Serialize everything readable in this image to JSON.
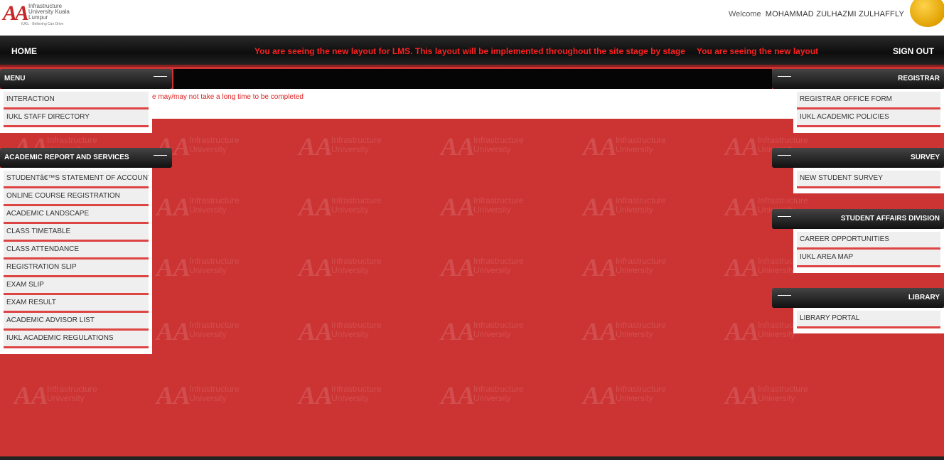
{
  "header": {
    "logo_mark": "AA",
    "logo_name": "Infrastructure University Kuala Lumpur",
    "logo_tagline": "IUKL · Believing Can Drive",
    "welcome_label": "Welcome",
    "user_name": "MOHAMMAD ZULHAZMI ZULHAFFLY"
  },
  "navbar": {
    "home": "HOME",
    "marquee_1": "You are seeing the new layout for LMS. This layout will be implemented throughout the site stage by stage",
    "marquee_2": "You are seeing the new layout",
    "signout": "SIGN OUT"
  },
  "notice": {
    "text": "e may/may not take a long time to be completed"
  },
  "left_menus": [
    {
      "title": "MENU",
      "toggle": "——",
      "items": [
        "INTERACTION",
        "IUKL STAFF DIRECTORY"
      ]
    },
    {
      "title": "ACADEMIC REPORT AND SERVICES",
      "toggle": "——",
      "items": [
        "STUDENTâ€™S STATEMENT OF ACCOUNT",
        "ONLINE COURSE REGISTRATION",
        "ACADEMIC LANDSCAPE",
        "CLASS TIMETABLE",
        "CLASS ATTENDANCE",
        "REGISTRATION SLIP",
        "EXAM SLIP",
        "EXAM RESULT",
        "ACADEMIC ADVISOR LIST",
        "IUKL ACADEMIC REGULATIONS"
      ]
    }
  ],
  "right_menus": [
    {
      "title": "REGISTRAR",
      "toggle": "——",
      "items": [
        "REGISTRAR OFFICE FORM",
        "IUKL ACADEMIC POLICIES"
      ]
    },
    {
      "title": "SURVEY",
      "toggle": "——",
      "items": [
        "NEW STUDENT SURVEY"
      ]
    },
    {
      "title": "STUDENT AFFAIRS DIVISION",
      "toggle": "——",
      "items": [
        "CAREER OPPORTUNITIES",
        "IUKL AREA MAP"
      ]
    },
    {
      "title": "LIBRARY",
      "toggle": "——",
      "items": [
        "LIBRARY PORTAL"
      ]
    }
  ],
  "colors": {
    "background": "#cc3333",
    "navbar": "#111111",
    "accent": "#ff2020"
  }
}
